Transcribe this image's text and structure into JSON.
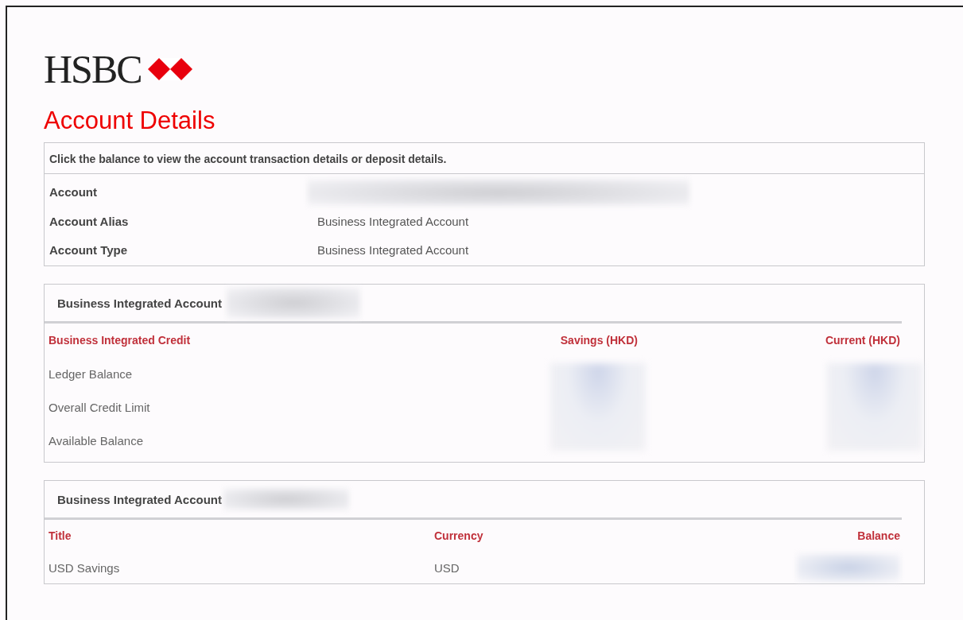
{
  "logo": {
    "text": "HSBC"
  },
  "title": "Account Details",
  "details": {
    "instruction": "Click the balance to view the account transaction details or deposit details.",
    "rows": [
      {
        "label": "Account",
        "value": "",
        "redacted": true
      },
      {
        "label": "Account Alias",
        "value": "Business Integrated Account",
        "redacted": false
      },
      {
        "label": "Account Type",
        "value": "Business Integrated Account",
        "redacted": false
      }
    ]
  },
  "credit": {
    "heading": "Business Integrated Account",
    "heading_redacted": true,
    "columns": [
      "Business Integrated Credit",
      "Savings (HKD)",
      "Current (HKD)"
    ],
    "rows": [
      {
        "label": "Ledger Balance"
      },
      {
        "label": "Overall Credit Limit"
      },
      {
        "label": "Available Balance"
      }
    ]
  },
  "savings": {
    "heading": "Business Integrated Account",
    "heading_redacted": true,
    "columns": [
      "Title",
      "Currency",
      "Balance"
    ],
    "rows": [
      {
        "title": "USD Savings",
        "currency": "USD",
        "balance_redacted": true
      }
    ]
  }
}
